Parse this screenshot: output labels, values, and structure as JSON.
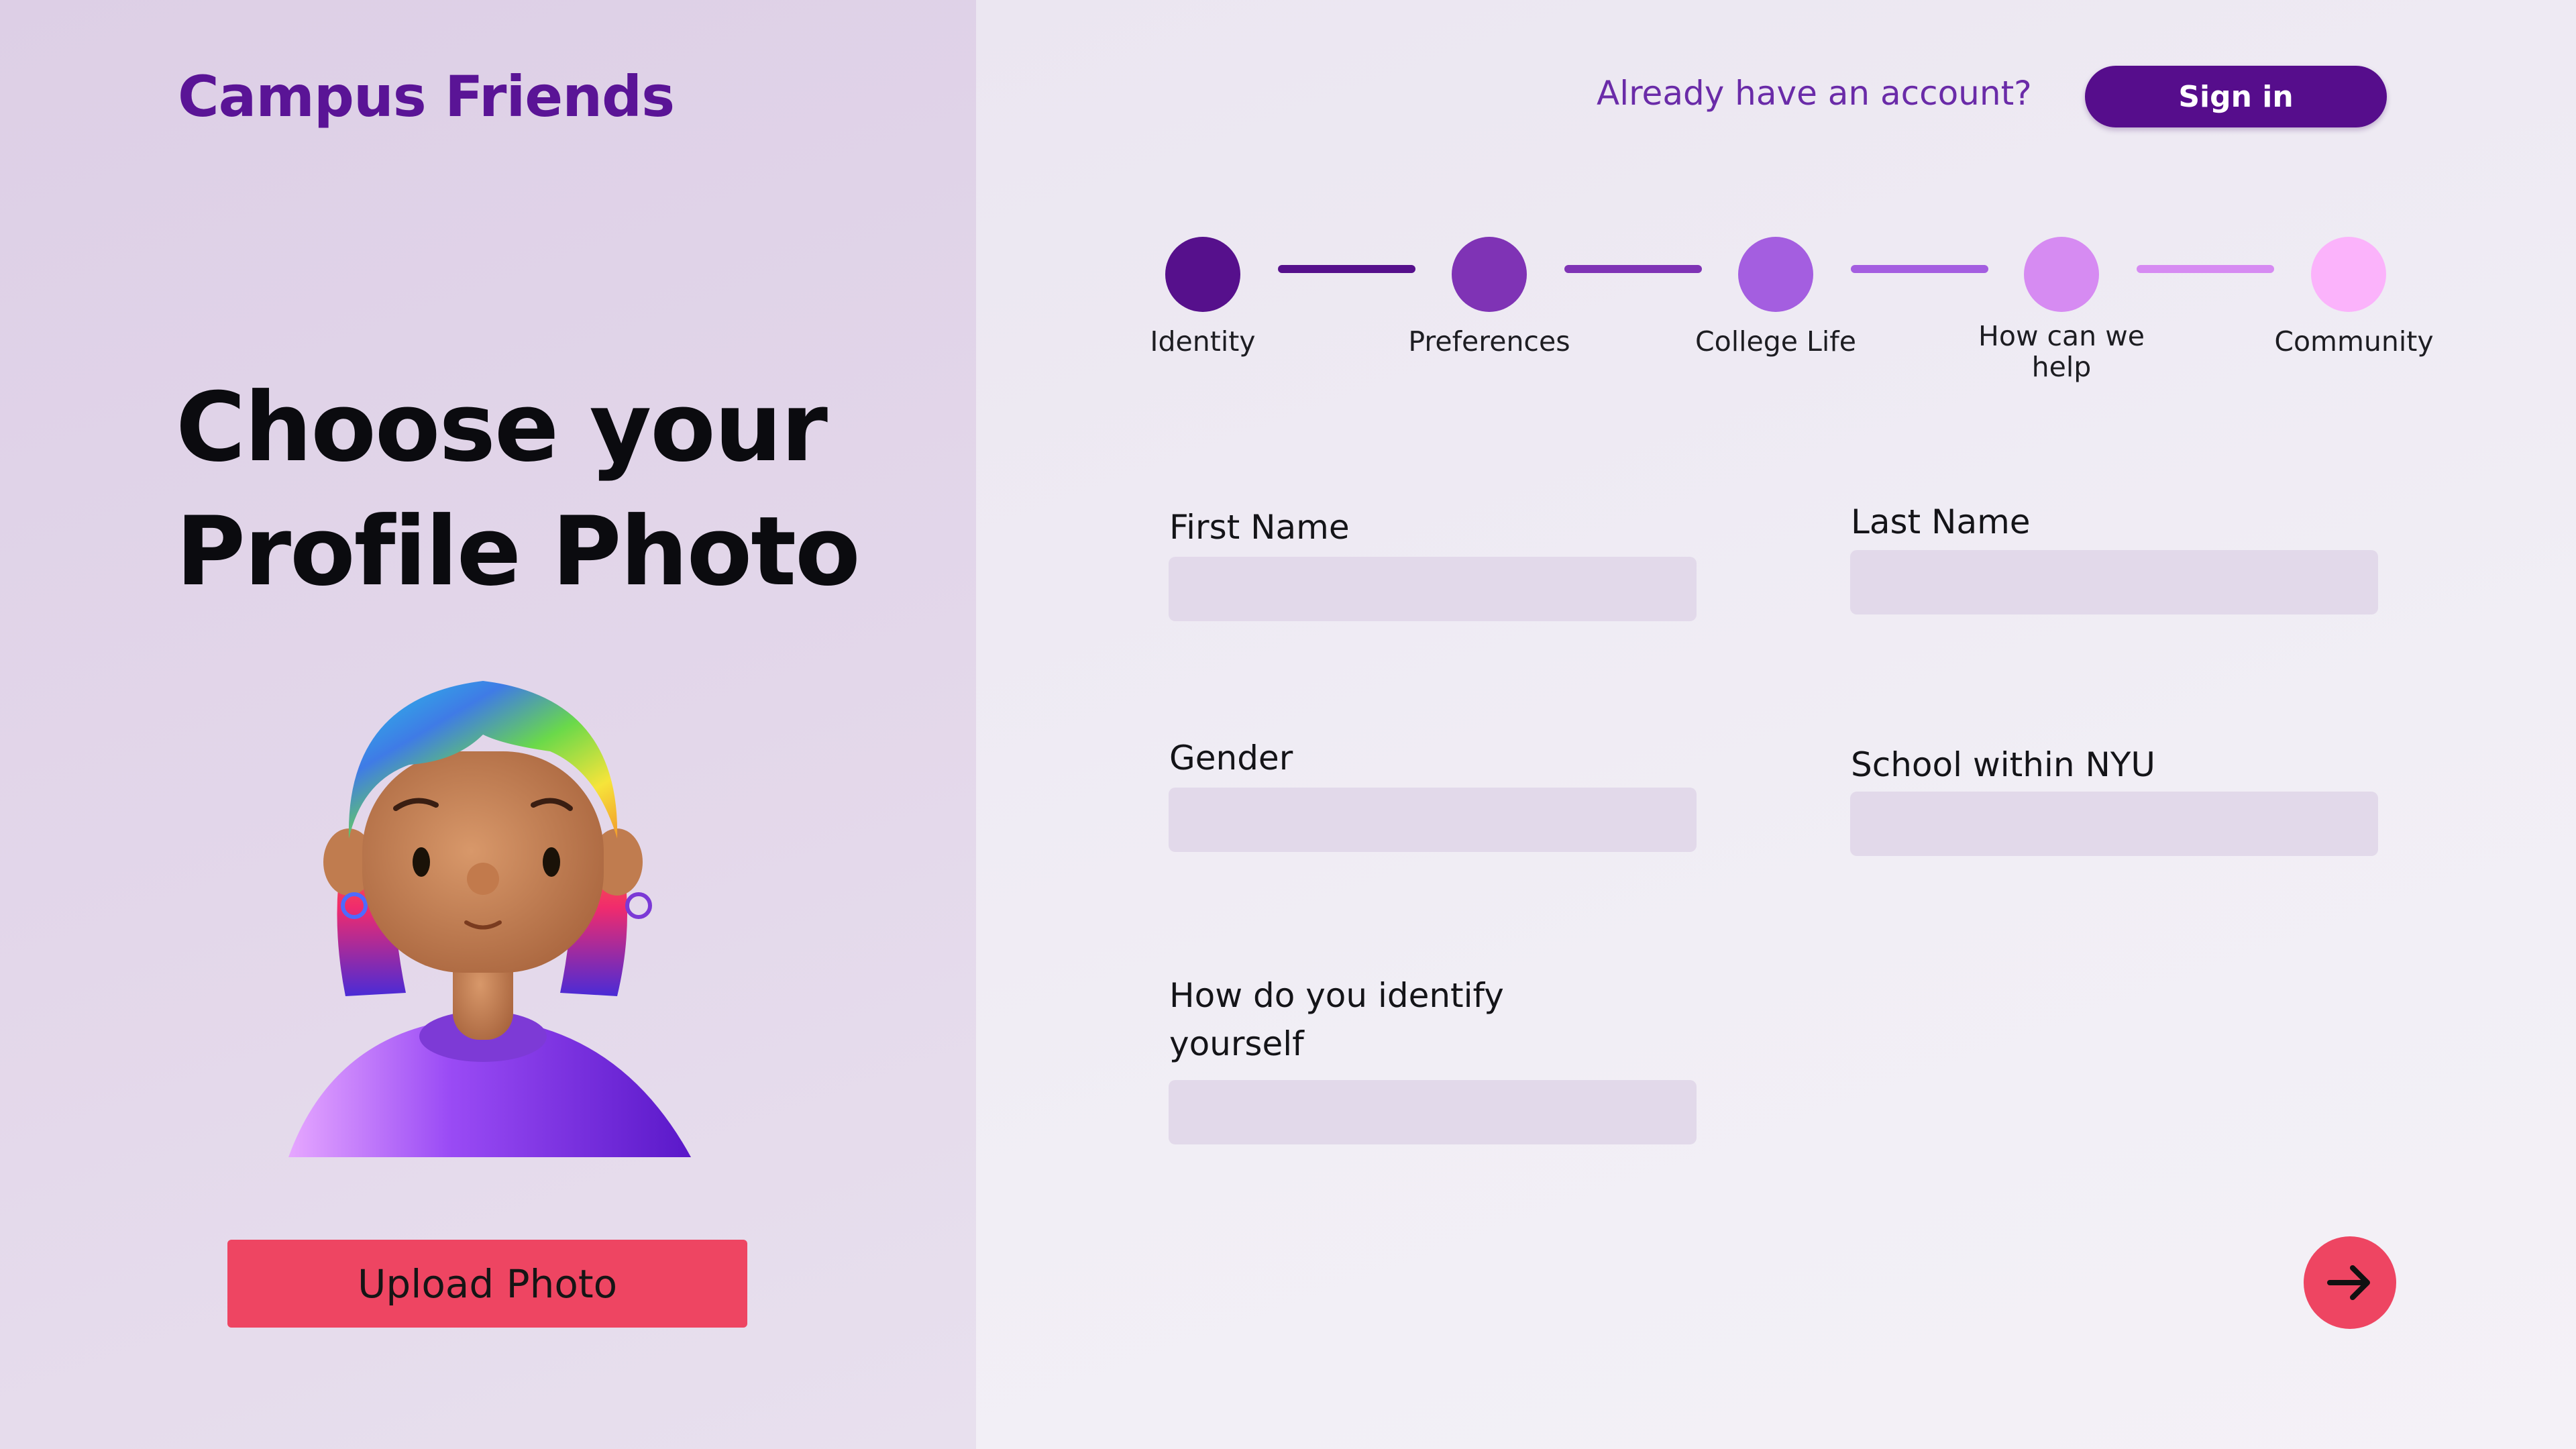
{
  "app": {
    "brand": "Campus Friends"
  },
  "header": {
    "account_prompt": "Already have an account?",
    "signin_label": "Sign in"
  },
  "left": {
    "heading_line1": "Choose your",
    "heading_line2": "Profile Photo",
    "upload_label": "Upload Photo"
  },
  "steps": [
    {
      "label": "Identity",
      "color": "#56108c"
    },
    {
      "label": "Preferences",
      "color": "#7f33b5"
    },
    {
      "label": "College Life",
      "color": "#a45ee0"
    },
    {
      "label": "How can we help",
      "color": "#d68bf2"
    },
    {
      "label": "Community",
      "color": "#fbb3fb"
    }
  ],
  "step_lines": [
    "#56108c",
    "#7f33b5",
    "#a45ee0",
    "#d68bf2"
  ],
  "form": {
    "first_name_label": "First Name",
    "last_name_label": "Last Name",
    "gender_label": "Gender",
    "school_label": "School within NYU",
    "identify_label": "How do you identify yourself",
    "first_name_value": "",
    "last_name_value": "",
    "gender_value": "",
    "school_value": "",
    "identify_value": ""
  },
  "icons": {
    "next": "arrow-right-icon",
    "avatar": "avatar-illustration"
  },
  "colors": {
    "brand": "#5a1496",
    "accent": "#ee4562",
    "signin_bg": "#560d8c",
    "input_bg": "#e2d9ea"
  }
}
